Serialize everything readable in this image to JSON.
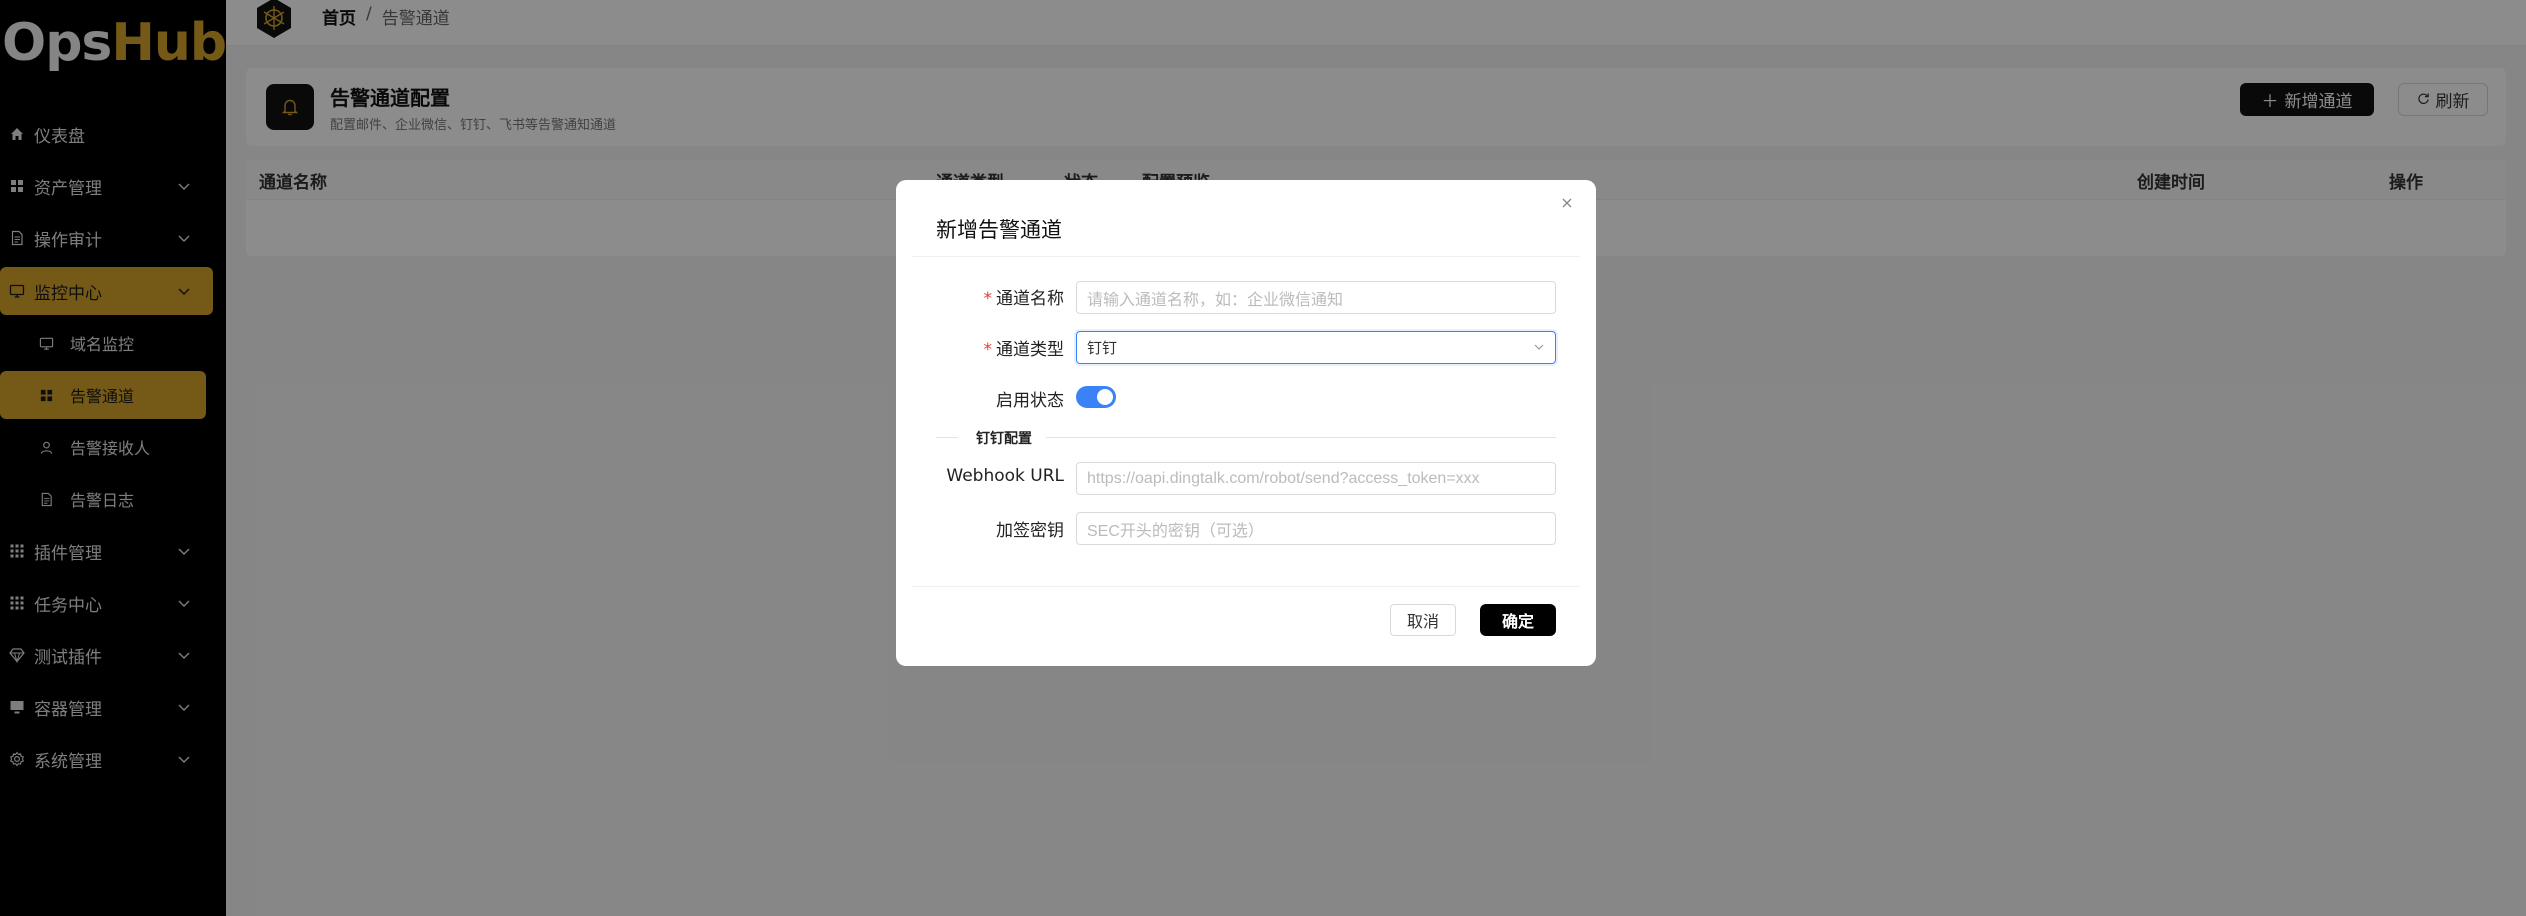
{
  "sidebar": {
    "logo_part1": "Ops",
    "logo_part2": "Hub",
    "items": [
      {
        "label": "仪表盘",
        "icon": "home-icon"
      },
      {
        "label": "资产管理",
        "icon": "grid-icon"
      },
      {
        "label": "操作审计",
        "icon": "document-icon"
      },
      {
        "label": "监控中心",
        "icon": "monitor-icon"
      },
      {
        "label": "插件管理",
        "icon": "apps-icon"
      },
      {
        "label": "任务中心",
        "icon": "apps-icon"
      },
      {
        "label": "测试插件",
        "icon": "gem-icon"
      },
      {
        "label": "容器管理",
        "icon": "desktop-icon"
      },
      {
        "label": "系统管理",
        "icon": "gear-icon"
      }
    ],
    "sub_items": [
      {
        "label": "域名监控",
        "icon": "monitor-icon"
      },
      {
        "label": "告警通道",
        "icon": "grid-icon"
      },
      {
        "label": "告警接收人",
        "icon": "user-icon"
      },
      {
        "label": "告警日志",
        "icon": "document-icon"
      }
    ]
  },
  "header": {
    "breadcrumb_home": "首页",
    "breadcrumb_sep": "/",
    "breadcrumb_current": "告警通道"
  },
  "page": {
    "title": "告警通道配置",
    "subtitle": "配置邮件、企业微信、钉钉、飞书等告警通知通道",
    "add_button": "新增通道",
    "refresh_button": "刷新"
  },
  "table": {
    "columns": [
      "通道名称",
      "通道类型",
      "状态",
      "配置预览",
      "创建时间",
      "操作"
    ]
  },
  "modal": {
    "title": "新增告警通道",
    "fields": {
      "name_label": "通道名称",
      "name_placeholder": "请输入通道名称，如：企业微信通知",
      "type_label": "通道类型",
      "type_value": "钉钉",
      "status_label": "启用状态",
      "status_enabled": true,
      "section_title": "钉钉配置",
      "webhook_label": "Webhook URL",
      "webhook_placeholder": "https://oapi.dingtalk.com/robot/send?access_token=xxx",
      "secret_label": "加签密钥",
      "secret_placeholder": "SEC开头的密钥（可选）"
    },
    "cancel_label": "取消",
    "ok_label": "确定"
  },
  "colors": {
    "accent": "#d6a22a",
    "primary": "#111111",
    "switch_on": "#3b82f6",
    "required": "#e23b3b"
  }
}
